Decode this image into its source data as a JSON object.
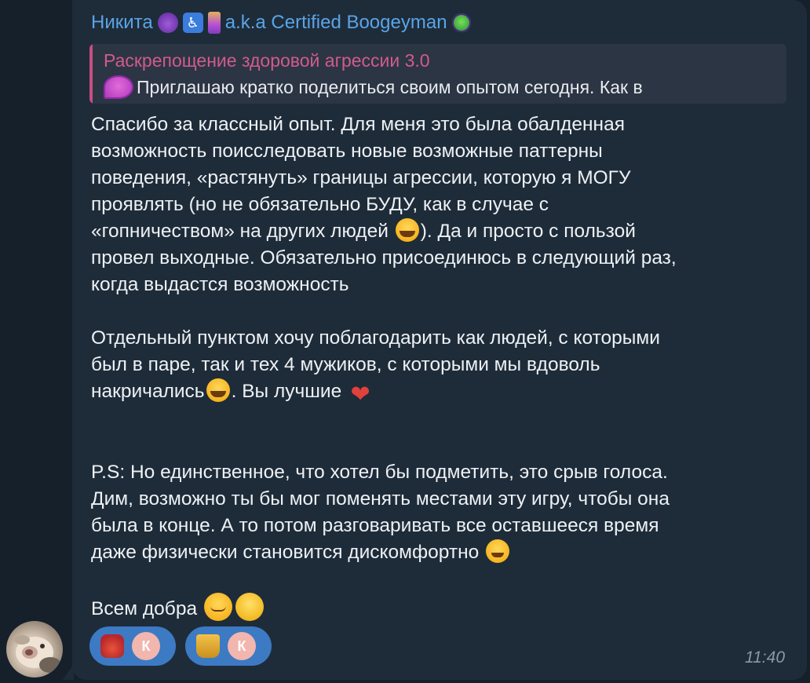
{
  "message": {
    "sender": {
      "name": "Никита",
      "alias": "a.k.a Certified Boogeyman"
    },
    "reply": {
      "title": "Раскрепощение здоровой агрессии 3.0",
      "text": "Приглашаю кратко поделиться своим опытом сегодня.  Как в"
    },
    "paragraphs": {
      "p1_l1": "Спасибо за классный опыт. Для меня это была обалденная",
      "p1_l2": "возможность поисследовать новые возможные паттерны",
      "p1_l3": "поведения, «растянуть» границы агрессии, которую я МОГУ",
      "p1_l4": "проявлять (но не обязательно БУДУ, как в случае с",
      "p1_l5a": "«гопничеством» на других людей",
      "p1_l5b": "). Да и просто с пользой",
      "p1_l6": "провел выходные. Обязательно присоединюсь в следующий раз,",
      "p1_l7": "когда выдастся возможность",
      "p2_l1": "Отдельный пунктом хочу поблагодарить как людей, с которыми",
      "p2_l2": "был в паре, так и тех 4 мужиков, с которыми мы вдоволь",
      "p2_l3a": "накричались",
      "p2_l3b": ". Вы лучшие",
      "p3_l1": "P.S: Но единственное, что хотел бы подметить, это срыв голоса.",
      "p3_l2": "Дим, возможно ты бы мог поменять местами эту игру, чтобы она",
      "p3_l3": "была в конце. А то потом разговаривать все оставшееся время",
      "p3_l4": "даже физически становится дискомфортно",
      "p4_l1": "Всем добра"
    },
    "reactions": [
      {
        "emoji": "heart-on-fire-icon",
        "user_initial": "К"
      },
      {
        "emoji": "trophy-icon",
        "user_initial": "К"
      }
    ],
    "time": "11:40"
  },
  "colors": {
    "background": "#15202b",
    "bubble": "#1e2c3a",
    "sender": "#5aa4e6",
    "reply_accent": "#c84e83",
    "reaction_pill": "#3d7ac4",
    "text": "#eef1f4"
  }
}
